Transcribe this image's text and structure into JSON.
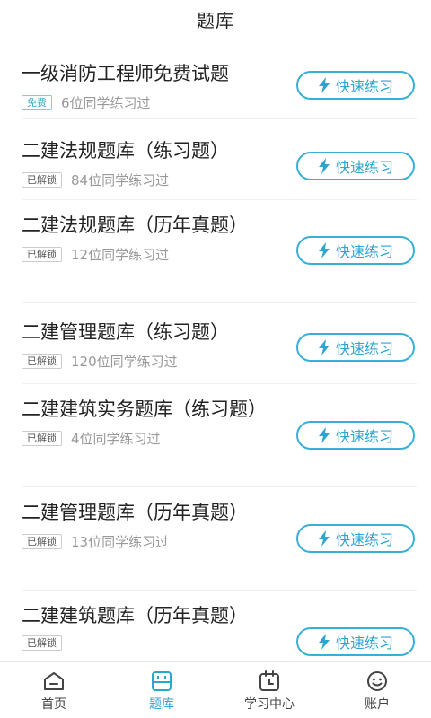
{
  "header": {
    "title": "题库"
  },
  "items": [
    {
      "title": "一级消防工程师免费试题",
      "tag": "免费",
      "free": true,
      "count": "6位同学练习过",
      "button": "快速练习"
    },
    {
      "title": "二建法规题库（练习题）",
      "tag": "已解锁",
      "free": false,
      "count": "84位同学练习过",
      "button": "快速练习"
    },
    {
      "title": "二建法规题库（历年真题）",
      "tag": "已解锁",
      "free": false,
      "count": "12位同学练习过",
      "button": "快速练习"
    },
    {
      "title": "二建管理题库（练习题）",
      "tag": "已解锁",
      "free": false,
      "count": "120位同学练习过",
      "button": "快速练习"
    },
    {
      "title": "二建建筑实务题库（练习题）",
      "tag": "已解锁",
      "free": false,
      "count": "4位同学练习过",
      "button": "快速练习"
    },
    {
      "title": "二建管理题库（历年真题）",
      "tag": "已解锁",
      "free": false,
      "count": "13位同学练习过",
      "button": "快速练习"
    },
    {
      "title": "二建建筑题库（历年真题）",
      "tag": "已解锁",
      "free": false,
      "count": "",
      "button": "快速练习"
    }
  ],
  "tabs": [
    {
      "label": "首页",
      "icon": "home-icon",
      "active": false
    },
    {
      "label": "题库",
      "icon": "question-bank-icon",
      "active": true
    },
    {
      "label": "学习中心",
      "icon": "calendar-icon",
      "active": false
    },
    {
      "label": "账户",
      "icon": "smiley-face-icon",
      "active": false
    }
  ],
  "colors": {
    "accent": "#2ea5cf",
    "text": "#222222",
    "muted": "#999999",
    "divider": "#f0f0f0"
  }
}
